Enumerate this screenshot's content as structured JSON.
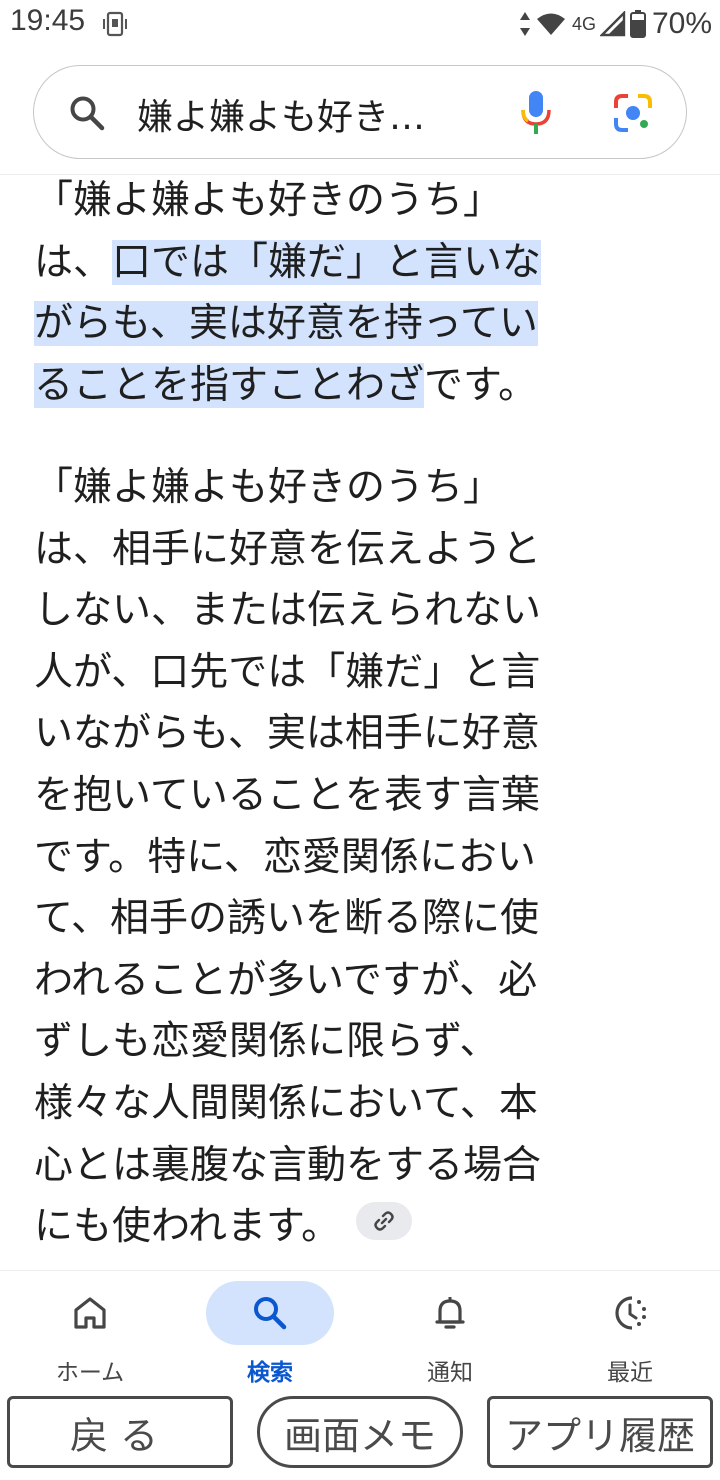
{
  "status_bar": {
    "time": "19:45",
    "network": "4G",
    "battery": "70%"
  },
  "search": {
    "query": "嫌よ嫌よも好き…",
    "icons": [
      "search-icon",
      "mic-icon",
      "lens-icon"
    ]
  },
  "content": {
    "paragraph1": {
      "line1": "「嫌よ嫌よも好きのうち」",
      "line2_plain": "は、",
      "line2_hl": "口では「嫌だ」と言いな",
      "line3_hl": "がらも、実は好意を持ってい",
      "line4_hl": "ることを指すことわざ",
      "line4_plain": "です。"
    },
    "paragraph2": {
      "lines": [
        "「嫌よ嫌よも好きのうち」",
        "は、相手に好意を伝えようと",
        "しない、または伝えられない",
        "人が、口先では「嫌だ」と言",
        "いながらも、実は相手に好意",
        "を抱いていることを表す言葉",
        "です。特に、恋愛関係におい",
        "て、相手の誘いを断る際に使",
        "われることが多いですが、必",
        "ずしも恋愛関係に限らず、",
        "様々な人間関係において、本",
        "心とは裏腹な言動をする場合"
      ],
      "last_line": "にも使われます。"
    }
  },
  "bottom_nav": {
    "items": [
      {
        "label": "ホーム",
        "icon": "home-icon",
        "active": false
      },
      {
        "label": "検索",
        "icon": "search-icon",
        "active": true
      },
      {
        "label": "通知",
        "icon": "bell-icon",
        "active": false
      },
      {
        "label": "最近",
        "icon": "recent-icon",
        "active": false
      }
    ]
  },
  "system_buttons": {
    "back": "戻る",
    "memo": "画面メモ",
    "history": "アプリ履歴"
  },
  "colors": {
    "highlight": "#d3e3fd",
    "active_nav": "#0b57d0",
    "text": "#1f1f1f"
  }
}
